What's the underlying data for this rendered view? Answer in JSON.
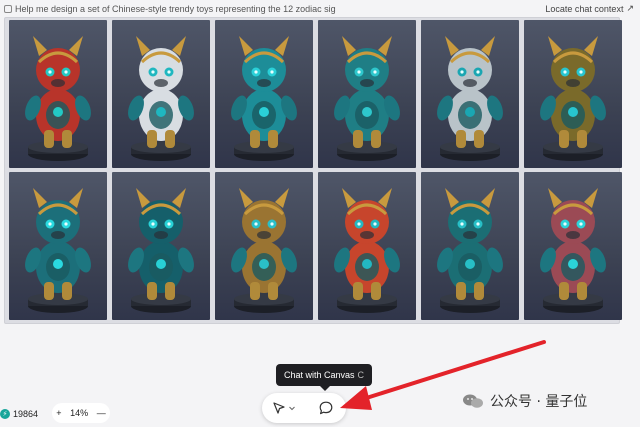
{
  "header": {
    "prompt": "Help me design a set of Chinese-style trendy toys representing the 12 zodiac sig",
    "locate_label": "Locate chat context",
    "locate_icon": "share-arrow-icon"
  },
  "gallery": {
    "tiles": [
      {
        "hue": "#b8342a",
        "accent": "#23c9c4"
      },
      {
        "hue": "#d8dde2",
        "accent": "#1fb7c0"
      },
      {
        "hue": "#1d8d98",
        "accent": "#2ad0d8"
      },
      {
        "hue": "#1f7e85",
        "accent": "#2ec7cc"
      },
      {
        "hue": "#b9c3c9",
        "accent": "#1aa6b2"
      },
      {
        "hue": "#7a6a2a",
        "accent": "#27c5d0"
      },
      {
        "hue": "#1c6f7a",
        "accent": "#2ad9e0"
      },
      {
        "hue": "#155f6a",
        "accent": "#28d1d6"
      },
      {
        "hue": "#9a7432",
        "accent": "#2abfc8"
      },
      {
        "hue": "#c7452c",
        "accent": "#23b8c2"
      },
      {
        "hue": "#1b6e74",
        "accent": "#27bfc6"
      },
      {
        "hue": "#9b4a55",
        "accent": "#2bd3d8"
      }
    ]
  },
  "status": {
    "credits": "19864",
    "credit_icon": "bolt-icon",
    "zoom_out": "+",
    "zoom_value": "14%",
    "zoom_in": "—"
  },
  "tooltip": {
    "label": "Chat with Canvas",
    "shortcut": "C"
  },
  "toolbar": {
    "select_icon": "pointer-arrow-icon",
    "dropdown_icon": "chevron-down-icon",
    "chat_icon": "chat-bubble-icon"
  },
  "watermark": {
    "text": "公众号 · 量子位"
  },
  "annotation": {
    "arrow_color": "#e3232a"
  }
}
